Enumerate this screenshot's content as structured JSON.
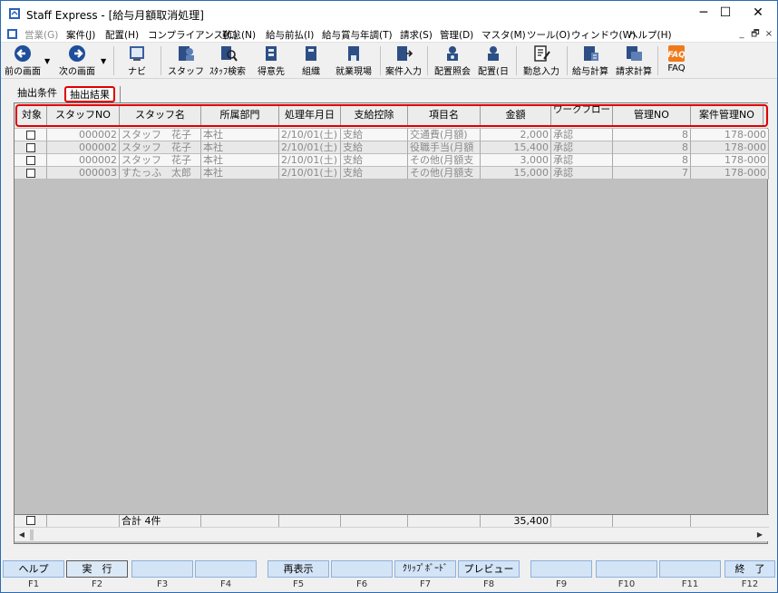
{
  "window": {
    "title": "Staff Express - [給与月額取消処理]",
    "controls": [
      "─",
      "☐",
      "✕"
    ],
    "mdi_controls": [
      "_",
      "🗗",
      "×"
    ]
  },
  "menu": [
    {
      "label": "営業(G)",
      "disabled": true
    },
    {
      "label": "案件(J)"
    },
    {
      "label": "配置(H)"
    },
    {
      "label": "コンプライアンス(C)"
    },
    {
      "label": "勤怠(N)"
    },
    {
      "label": "給与前払(I)"
    },
    {
      "label": "給与賞与年調(T)"
    },
    {
      "label": "請求(S)"
    },
    {
      "label": "管理(D)"
    },
    {
      "label": "マスタ(M)"
    },
    {
      "label": "ツール(O)"
    },
    {
      "label": "ウィンドウ(W)"
    },
    {
      "label": "ヘルプ(H)"
    }
  ],
  "toolbar": [
    {
      "label": "前の画面",
      "icon": "back-arrow-icon"
    },
    {
      "label": "次の画面",
      "icon": "forward-arrow-icon"
    },
    {
      "label": "ナビ",
      "icon": "navi-icon"
    },
    {
      "label": "スタッフ",
      "icon": "staff-icon"
    },
    {
      "label": "ｽﾀｯﾌ検索",
      "icon": "staff-search-icon"
    },
    {
      "label": "得意先",
      "icon": "customer-icon"
    },
    {
      "label": "組織",
      "icon": "organization-icon"
    },
    {
      "label": "就業現場",
      "icon": "worksite-icon"
    },
    {
      "label": "案件入力",
      "icon": "job-entry-icon"
    },
    {
      "label": "配置照会",
      "icon": "placement-inquiry-icon"
    },
    {
      "label": "配置(日",
      "icon": "placement-daily-icon"
    },
    {
      "label": "勤怠入力",
      "icon": "attendance-entry-icon"
    },
    {
      "label": "給与計算",
      "icon": "payroll-calc-icon"
    },
    {
      "label": "請求計算",
      "icon": "billing-calc-icon"
    },
    {
      "label": "FAQ",
      "icon": "faq-icon"
    }
  ],
  "tabs": {
    "conditions": "抽出条件",
    "results": "抽出結果"
  },
  "grid": {
    "columns": [
      "対象",
      "スタッフNO",
      "スタッフ名",
      "所属部門",
      "処理年月日",
      "支給控除",
      "項目名",
      "金額",
      "ワークフロー",
      "管理NO",
      "案件管理NO"
    ],
    "rows": [
      {
        "staff_no": "000002",
        "staff_name": "スタッフ　花子",
        "dept": "本社",
        "date": "2/10/01(土)",
        "type": "支給",
        "item": "交通費(月額)",
        "amount": "2,000",
        "workflow": "承認",
        "mgmt_no": "8",
        "job_no": "178-000"
      },
      {
        "staff_no": "000002",
        "staff_name": "スタッフ　花子",
        "dept": "本社",
        "date": "2/10/01(土)",
        "type": "支給",
        "item": "役職手当(月額",
        "amount": "15,400",
        "workflow": "承認",
        "mgmt_no": "8",
        "job_no": "178-000"
      },
      {
        "staff_no": "000002",
        "staff_name": "スタッフ　花子",
        "dept": "本社",
        "date": "2/10/01(土)",
        "type": "支給",
        "item": "その他(月額支",
        "amount": "3,000",
        "workflow": "承認",
        "mgmt_no": "8",
        "job_no": "178-000"
      },
      {
        "staff_no": "000003",
        "staff_name": "すたっふ　太郎",
        "dept": "本社",
        "date": "2/10/01(土)",
        "type": "支給",
        "item": "その他(月額支",
        "amount": "15,000",
        "workflow": "承認",
        "mgmt_no": "7",
        "job_no": "178-000"
      }
    ],
    "footer": {
      "total_label": "合計 4件",
      "total_amount": "35,400"
    }
  },
  "fkeys": [
    {
      "label": "ヘルプ",
      "key": "F1"
    },
    {
      "label": "実　行",
      "key": "F2"
    },
    {
      "label": "",
      "key": "F3"
    },
    {
      "label": "",
      "key": "F4"
    },
    {
      "label": "再表示",
      "key": "F5"
    },
    {
      "label": "",
      "key": "F6"
    },
    {
      "label": "ｸﾘｯﾌﾟﾎﾞｰﾄﾞ",
      "key": "F7"
    },
    {
      "label": "プレビュー",
      "key": "F8"
    },
    {
      "label": "",
      "key": "F9"
    },
    {
      "label": "",
      "key": "F10"
    },
    {
      "label": "",
      "key": "F11"
    },
    {
      "label": "終　了",
      "key": "F12"
    }
  ],
  "colors": {
    "highlight": "#e00000",
    "fkey": "#d3e4f7",
    "grid_bg": "#c0c0c0"
  }
}
